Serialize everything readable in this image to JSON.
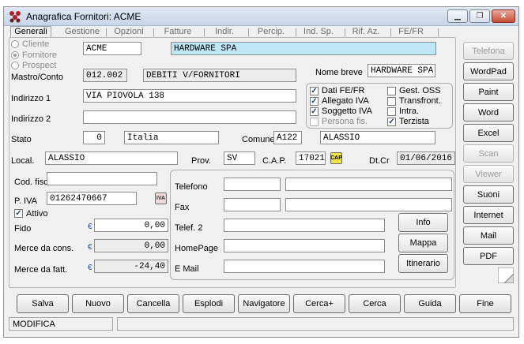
{
  "window": {
    "title": "Anagrafica Fornitori: ACME"
  },
  "tabs": [
    "Generali",
    "Gestione",
    "Opzioni",
    "Fatture",
    "Indir.",
    "Percip.",
    "Ind. Sp.",
    "Rif. Az.",
    "FE/FR"
  ],
  "type_radios": [
    "Cliente",
    "Fornitore",
    "Prospect"
  ],
  "labels": {
    "mastro": "Mastro/Conto",
    "nome_breve": "Nome breve",
    "indirizzo1": "Indirizzo 1",
    "indirizzo2": "Indirizzo 2",
    "stato": "Stato",
    "comune": "Comune",
    "local": "Local.",
    "prov": "Prov.",
    "cap": "C.A.P.",
    "dtcr": "Dt.Cr",
    "codfisc": "Cod. fisc.",
    "piva": "P. IVA",
    "attivo": "Attivo",
    "fido": "Fido",
    "merce_cons": "Merce da cons.",
    "merce_fatt": "Merce da fatt.",
    "telefono": "Telefono",
    "fax": "Fax",
    "telef2": "Telef. 2",
    "homepage": "HomePage",
    "email": "E Mail"
  },
  "fields": {
    "code": "ACME",
    "ragione_sociale": "HARDWARE SPA",
    "mastro": "012.002",
    "mastro_desc": "DEBITI V/FORNITORI",
    "nome_breve": "HARDWARE SPA",
    "indirizzo1": "VIA PIOVOLA 138",
    "indirizzo2": "",
    "stato_code": "0",
    "stato": "Italia",
    "comune_code": "A122",
    "comune": "ALASSIO",
    "localita": "ALASSIO",
    "prov": "SV",
    "cap": "17021",
    "dtcr": "01/06/2016",
    "codfisc": "",
    "piva": "01262470667",
    "fido": "0,00",
    "merce_cons": "0,00",
    "merce_fatt": "-24,40",
    "telefono": "",
    "telefono_desc": "",
    "fax": "",
    "fax_desc": "",
    "telef2": "",
    "homepage": "",
    "email": ""
  },
  "flags": [
    "Dati FE/FR",
    "Allegato IVA",
    "Soggetto IVA",
    "Persona fis.",
    "Gest. OSS",
    "Transfront.",
    "Intra.",
    "Terzista"
  ],
  "side_buttons": [
    "Telefona",
    "WordPad",
    "Paint",
    "Word",
    "Excel",
    "Scan",
    "Viewer",
    "Suoni",
    "Internet",
    "Mail",
    "PDF"
  ],
  "contact_buttons": [
    "Info",
    "Mappa",
    "Itinerario"
  ],
  "bottom_buttons": [
    "Salva",
    "Nuovo",
    "Cancella",
    "Esplodi",
    "Navigatore",
    "Cerca+",
    "Cerca",
    "Guida",
    "Fine"
  ],
  "status": {
    "mode": "MODIFICA",
    "message": ""
  },
  "icons": {
    "cap_lookup": "CAP",
    "piva_check": "IVA",
    "currency": "€"
  }
}
